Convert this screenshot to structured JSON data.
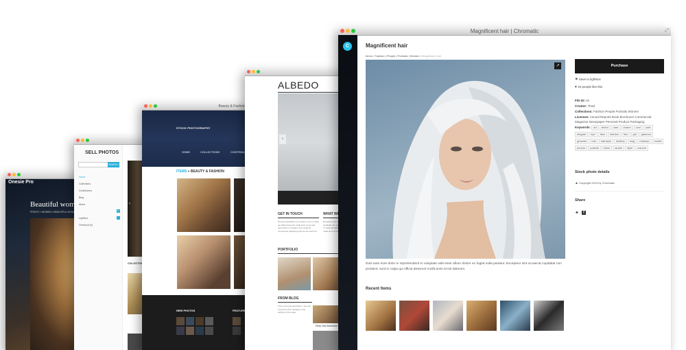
{
  "onesie": {
    "brand": "Onesie Pro",
    "hero_title": "Beautiful woman",
    "breadcrumb": "PRINTS » WOMEN » BEAUTIFUL WOMAN"
  },
  "sell": {
    "title": "SELL PHOTOS",
    "search_button": "SEARCH",
    "menu": [
      "Home",
      "Collections",
      "Contributors",
      "Blog",
      "About",
      "Lightbox",
      "Checkout (0)"
    ],
    "lightbox_count": "0",
    "collections_label": "COLLECTIONS"
  },
  "beauty": {
    "window_title": "Beauty & Fashion",
    "logo": "STOCK PHOTOGRAPHY",
    "nav": [
      "HOME",
      "COLLECTIONS",
      "CONTRIBU"
    ],
    "heading_link": "ITEMS",
    "heading_rest": " » BEAUTY & FASHION",
    "footer_left": "NEW PHOTOS",
    "footer_right": "FEATURE"
  },
  "albedo": {
    "logo": "ALBEDO",
    "get_in_touch": "GET IN TOUCH",
    "what_we": "WHAT WE",
    "touch_text": "Donecet ligulafeid nec proident, sunt in culpa qui officia deserunt mollit anim id est and uses field in excepteur sint occaecat consectetur adipiscing elit sed do eiusmod.",
    "what_text": "Excepteur sint occaecat cupidatat non proident, sunt in culpa qui officia deserunt mollit anim id est.",
    "portfolio": "PORTFOLIO",
    "from_blog": "FROM BLOG",
    "blog_text": "This is the blog description. You can customize this message in the settings of the page.",
    "blog_post": "Deep Sea Adventure"
  },
  "main": {
    "window_title": "Magnificent hair | Chromatic",
    "logo_letter": "C",
    "page_title": "Magnificent hair",
    "breadcrumb": [
      "Items",
      "Fashion",
      "People",
      "Portraits",
      "Women",
      "Magnificent hair"
    ],
    "purchase": "Purchase",
    "save_lightbox": "Save to lightbox",
    "likes": "10",
    "likes_text": "people like this",
    "file_id_label": "File ID:",
    "file_id": "81",
    "creator_label": "Creator:",
    "creator": "Thad",
    "collections_label": "Collections:",
    "collections": "Fashion People Portraits Women",
    "licenses_label": "Licenses:",
    "licenses": "Annual Reports Book Brochures Commercial Magazine Newspaper Personal Product Packaging",
    "keywords_label": "Keywords:",
    "keywords": [
      "art",
      "blond",
      "care",
      "charm",
      "cool",
      "cute",
      "elegant",
      "eye",
      "face",
      "fashion",
      "fine",
      "girl",
      "glamour",
      "graceful",
      "hair",
      "hairstyle",
      "healthy",
      "long",
      "makeup",
      "model",
      "person",
      "portrait",
      "shine",
      "studio",
      "style",
      "volume"
    ],
    "details_heading": "Stock photo details",
    "copyright": "Copyright  2013 by Chromatic",
    "share_heading": "Share",
    "description": "Duis aute irure dolor in reprehenderit in voluptate velit esse cillum dolore eu fugiat nulla pariatur. Excepteur sint occaecat cupidatat non proident, sunt in culpa qui officia deserunt mollit anim id est laborum.",
    "recent_heading": "Recent Items",
    "accent": "#29c4ea"
  }
}
